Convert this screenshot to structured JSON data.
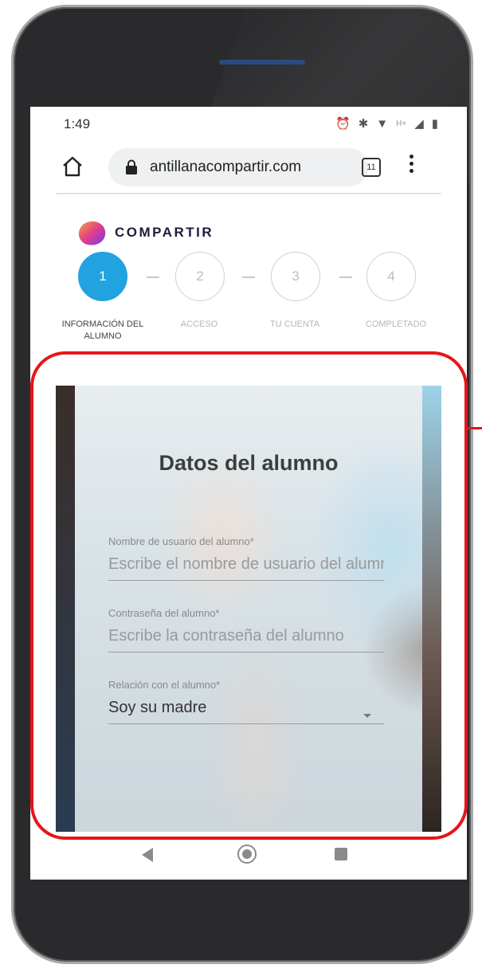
{
  "status_bar": {
    "time": "1:49",
    "icons": [
      "alarm-icon",
      "bluetooth-icon",
      "wifi-icon",
      "h-plus-icon",
      "signal-icon",
      "battery-icon"
    ],
    "network": "H+"
  },
  "browser": {
    "url": "antillanacompartir.com",
    "tab_count": "11"
  },
  "brand": {
    "name": "COMPARTIR",
    "gradient": [
      "#f2a33a",
      "#e23d8b",
      "#6a3df0"
    ]
  },
  "stepper": {
    "active_color": "#21a3e0",
    "steps": [
      {
        "number": "1",
        "label": "INFORMACIÓN DEL ALUMNO",
        "active": true
      },
      {
        "number": "2",
        "label": "ACCESO",
        "active": false
      },
      {
        "number": "3",
        "label": "TU CUENTA",
        "active": false
      },
      {
        "number": "4",
        "label": "COMPLETADO",
        "active": false
      }
    ]
  },
  "form": {
    "title": "Datos del alumno",
    "fields": [
      {
        "label": "Nombre de usuario del alumno*",
        "placeholder": "Escribe el nombre de usuario del alumno"
      },
      {
        "label": "Contraseña del alumno*",
        "placeholder": "Escribe la contraseña del alumno"
      },
      {
        "label": "Relación con el alumno*",
        "value": "Soy su madre"
      }
    ]
  },
  "annotation": {
    "color": "#e8141a"
  },
  "android_nav": {
    "icons": [
      "back-icon",
      "home-icon",
      "recents-icon"
    ]
  }
}
